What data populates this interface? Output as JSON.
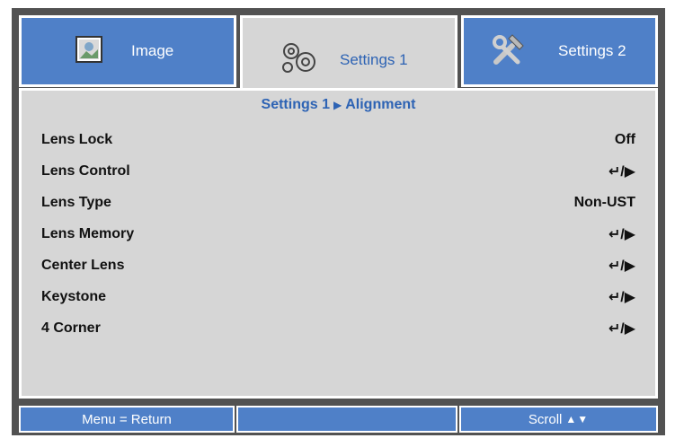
{
  "tabs": [
    {
      "label": "Image",
      "icon": "image-icon"
    },
    {
      "label": "Settings 1",
      "icon": "gears-icon",
      "active": true
    },
    {
      "label": "Settings 2",
      "icon": "tools-icon"
    }
  ],
  "breadcrumb": {
    "section": "Settings 1",
    "separator": "▶",
    "page": "Alignment"
  },
  "menu": {
    "items": [
      {
        "label": "Lens Lock",
        "value": "Off"
      },
      {
        "label": "Lens Control",
        "value": "↵/▶"
      },
      {
        "label": "Lens Type",
        "value": "Non-UST"
      },
      {
        "label": "Lens Memory",
        "value": "↵/▶"
      },
      {
        "label": "Center Lens",
        "value": "↵/▶"
      },
      {
        "label": "Keystone",
        "value": "↵/▶"
      },
      {
        "label": "4 Corner",
        "value": "↵/▶"
      }
    ]
  },
  "footer": {
    "menu_return": "Menu = Return",
    "middle": "",
    "scroll": "Scroll",
    "scroll_arrows": "▲▼"
  },
  "colors": {
    "tab_blue": "#4f80c8",
    "accent_text": "#2d63b4",
    "panel_gray": "#d6d6d6",
    "frame_dark": "#525252"
  }
}
